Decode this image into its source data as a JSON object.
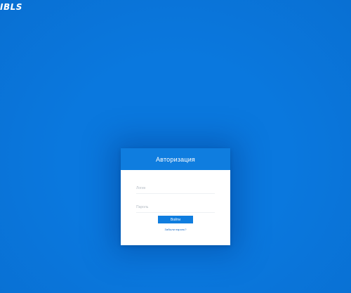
{
  "brand": {
    "logo_text": "IBLS"
  },
  "login_form": {
    "title": "Авторизация",
    "login_placeholder": "Логин",
    "password_placeholder": "Пароль",
    "submit_label": "Войти",
    "forgot_password_label": "Забыли пароль?"
  },
  "colors": {
    "background": "#0a78de",
    "accent": "#0f7ddf",
    "card": "#ffffff"
  }
}
